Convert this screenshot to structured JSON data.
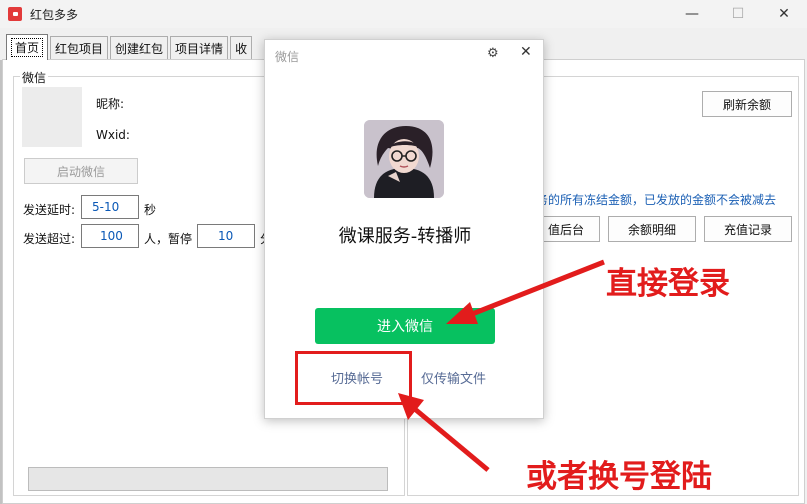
{
  "window": {
    "title": "红包多多",
    "min_glyph": "—",
    "max_glyph": "☐",
    "close_glyph": "✕"
  },
  "tabs": [
    {
      "label": "首页"
    },
    {
      "label": "红包项目"
    },
    {
      "label": "创建红包"
    },
    {
      "label": "项目详情"
    },
    {
      "label": "收"
    }
  ],
  "wechat_group": {
    "legend": "微信",
    "nickname_label": "昵称:",
    "wxid_label": "Wxid:",
    "start_button": "启动微信",
    "send_delay_label": "发送延时:",
    "send_delay_value": "5-10",
    "send_delay_unit": "秒",
    "send_over_label": "发送超过:",
    "send_over_value": "100",
    "send_over_unit": "人，暂停",
    "pause_value": "10",
    "pause_unit": "分",
    "progress": 0
  },
  "right_group": {
    "refresh_button": "刷新余额",
    "note": "务的所有冻结金额，已发放的金额不会被减去",
    "recharge_backend_button": "值后台",
    "balance_detail_button": "余额明细",
    "recharge_record_button": "充值记录"
  },
  "dialog": {
    "title": "微信",
    "gear_glyph": "⚙",
    "close_glyph": "✕",
    "account_name": "微课服务-转播师",
    "login_button": "进入微信",
    "switch_account_link": "切换帐号",
    "file_transfer_link": "仅传输文件"
  },
  "annotations": {
    "direct_login": "直接登录",
    "switch_login": "或者换号登陆",
    "color": "#e21c1c"
  }
}
